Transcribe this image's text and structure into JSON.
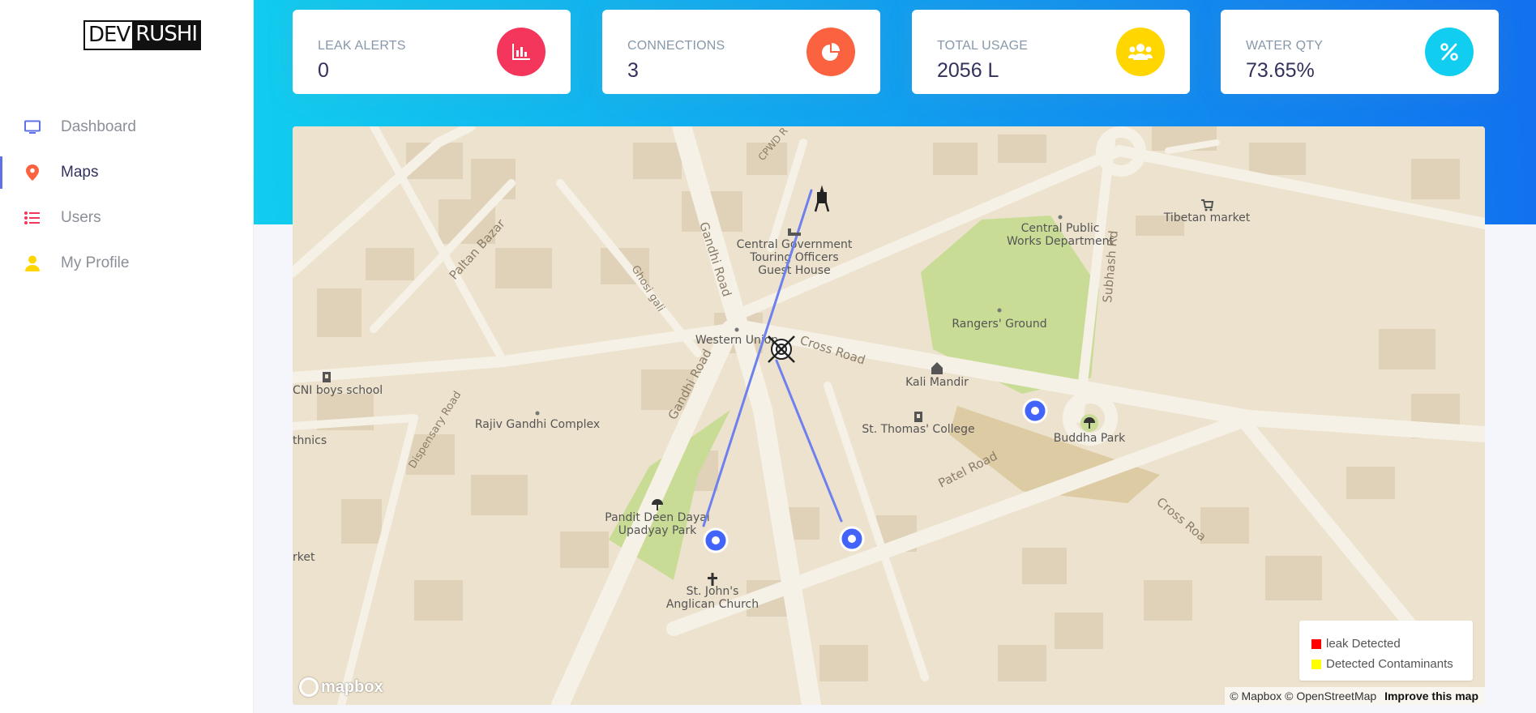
{
  "brand": {
    "part1": "DEV",
    "part2": "RUSHI"
  },
  "nav": [
    {
      "label": "Dashboard",
      "icon": "monitor-icon",
      "color": "#5e72e4",
      "active": false
    },
    {
      "label": "Maps",
      "icon": "map-pin-icon",
      "color": "#fb6340",
      "active": true
    },
    {
      "label": "Users",
      "icon": "list-icon",
      "color": "#f5365c",
      "active": false
    },
    {
      "label": "My Profile",
      "icon": "user-icon",
      "color": "#ffd600",
      "active": false
    }
  ],
  "stats": [
    {
      "title": "LEAK ALERTS",
      "value": "0",
      "icon": "chart-bar-icon",
      "color": "#f5365c"
    },
    {
      "title": "CONNECTIONS",
      "value": "3",
      "icon": "chart-pie-icon",
      "color": "#fb6340"
    },
    {
      "title": "TOTAL USAGE",
      "value": "2056 L",
      "icon": "users-icon",
      "color": "#ffd600"
    },
    {
      "title": "WATER QTY",
      "value": "73.65%",
      "icon": "percent-icon",
      "color": "#11cdef"
    }
  ],
  "map": {
    "labels": {
      "gandhi_road_top": "Gandhi Road",
      "gandhi_road_bottom": "Gandhi Road",
      "cpwd": "CPWD R",
      "paltan_bazar": "Paltan Bazar",
      "ghosi_gali": "Ghosi gali",
      "guest_house": [
        "Central Government",
        "Touring Officers",
        "Guest House"
      ],
      "cpwd_office": [
        "Central Public",
        "Works Department"
      ],
      "tibetan_market": "Tibetan market",
      "subhash_rd": "Subhash Rd",
      "rangers_ground": "Rangers' Ground",
      "western_union": "Western Union",
      "cross_road": "Cross Road",
      "kali_mandir": "Kali Mandir",
      "cni_school": "CNI boys school",
      "st_thomas": "St. Thomas' College",
      "rajiv_gandhi": "Rajiv Gandhi Complex",
      "dispensary_road": "Dispensary Road",
      "buddha_park": "Buddha Park",
      "patel_road": "Patel Road",
      "cross_road_2": "Cross Roa",
      "pandit_park": [
        "Pandit Deen Dayal",
        "Upadyay Park"
      ],
      "st_johns": [
        "St. John's",
        "Anglican Church"
      ],
      "thnics": "thnics",
      "rket": "rket"
    },
    "legend": [
      {
        "label": "leak Detected",
        "color": "#ff0000"
      },
      {
        "label": "Detected Contaminants",
        "color": "#ffff00"
      }
    ],
    "attribution": "© Mapbox © OpenStreetMap",
    "improve": "Improve this map",
    "mapbox_logo": "mapbox"
  }
}
